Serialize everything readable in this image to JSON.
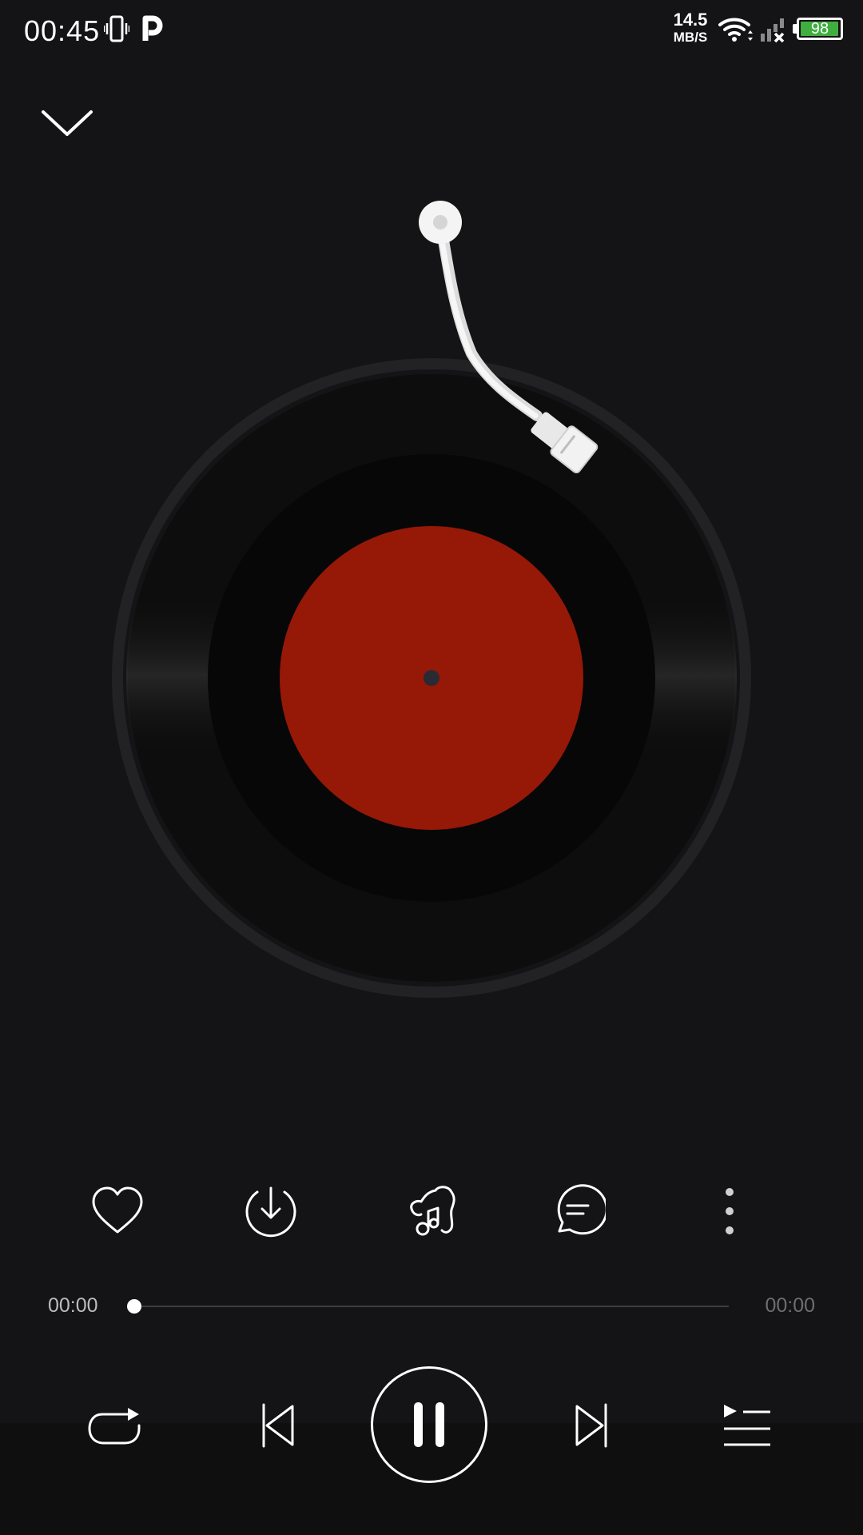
{
  "status_bar": {
    "time": "00:45",
    "net_speed_value": "14.5",
    "net_speed_unit": "MB/S",
    "battery_level": "98",
    "battery_fraction": 0.98,
    "icons": [
      "vibrate-icon",
      "p-app-icon",
      "wifi-icon",
      "signal-no-service-icon",
      "battery-icon"
    ]
  },
  "header": {
    "collapse_icon": "chevron-down-icon"
  },
  "record": {
    "label_color": "#961807",
    "disc_color": "#0a0a0a",
    "arm_color": "#eeeeee"
  },
  "actions": [
    {
      "name": "like-button",
      "icon": "heart-icon"
    },
    {
      "name": "download-button",
      "icon": "download-icon"
    },
    {
      "name": "music-style-button",
      "icon": "music-note-icon"
    },
    {
      "name": "comments-button",
      "icon": "comment-icon"
    },
    {
      "name": "more-button",
      "icon": "more-vertical-icon"
    }
  ],
  "progress": {
    "current_time": "00:00",
    "total_time": "00:00",
    "fraction": 0.0
  },
  "controls": [
    {
      "name": "repeat-button",
      "icon": "repeat-icon"
    },
    {
      "name": "previous-button",
      "icon": "previous-icon"
    },
    {
      "name": "pause-button",
      "icon": "pause-icon"
    },
    {
      "name": "next-button",
      "icon": "next-icon"
    },
    {
      "name": "playlist-button",
      "icon": "playlist-icon"
    }
  ]
}
